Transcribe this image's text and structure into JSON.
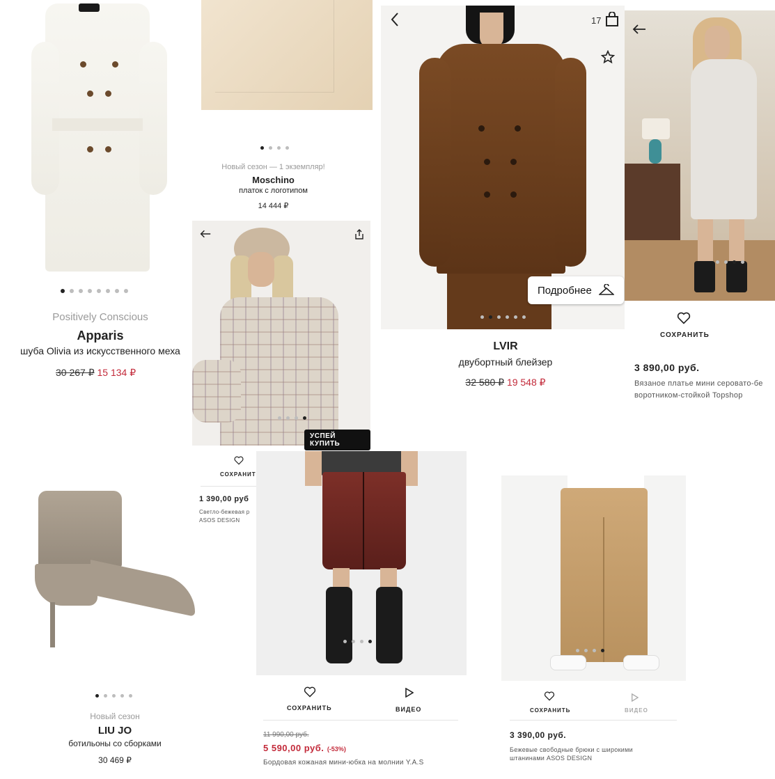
{
  "apparis": {
    "season": "Positively Conscious",
    "brand": "Apparis",
    "desc": "шуба Olivia из искусственного меха",
    "old_price": "30 267 ₽",
    "new_price": "15 134 ₽",
    "slides": 8,
    "active_slide": 1
  },
  "moschino": {
    "season": "Новый сезон — 1 экземпляр!",
    "brand": "Moschino",
    "desc": "платок с логотипом",
    "price": "14 444 ₽",
    "slides": 4,
    "active_slide": 1
  },
  "lvir": {
    "cart_count": "17",
    "details_button": "Подробнее",
    "brand": "LVIR",
    "desc": "двубортный блейзер",
    "old_price": "32 580 ₽",
    "new_price": "19 548 ₽",
    "slides": 6,
    "active_slide": 2
  },
  "topshop": {
    "save_label": "СОХРАНИТЬ",
    "price": "3 890,00 руб.",
    "desc_line1": "Вязаное платье мини серовато-бе",
    "desc_line2": "воротником-стойкой Topshop",
    "slides": 4,
    "active_slide": 3
  },
  "plaid": {
    "badge": "УСПЕЙ КУПИТЬ",
    "save_label": "СОХРАНИТЬ",
    "price": "1 390,00 руб",
    "desc_line1": "Светло-бежевая р",
    "desc_line2": "ASOS DESIGN",
    "slides": 4,
    "active_slide": 4
  },
  "skirt": {
    "save_label": "СОХРАНИТЬ",
    "video_label": "ВИДЕО",
    "old_price": "11 990,00 руб.",
    "new_price": "5 590,00 руб.",
    "discount": "(-53%)",
    "desc": "Бордовая кожаная мини-юбка на молнии Y.A.S",
    "slides": 4,
    "active_slide": 4
  },
  "trousers": {
    "save_label": "СОХРАНИТЬ",
    "video_label": "ВИДЕО",
    "price": "3 390,00 руб.",
    "desc_line1": "Бежевые свободные брюки с широкими",
    "desc_line2": "штанинами ASOS DESIGN",
    "slides": 4,
    "active_slide": 4
  },
  "liujo": {
    "season": "Новый сезон",
    "brand": "LIU JO",
    "desc": "ботильоны со сборками",
    "price": "30 469 ₽",
    "slides": 5,
    "active_slide": 1
  },
  "icons": [
    "back-arrow-icon",
    "shopping-bag-icon",
    "star-icon",
    "hanger-icon",
    "heart-icon",
    "share-icon",
    "play-icon"
  ]
}
